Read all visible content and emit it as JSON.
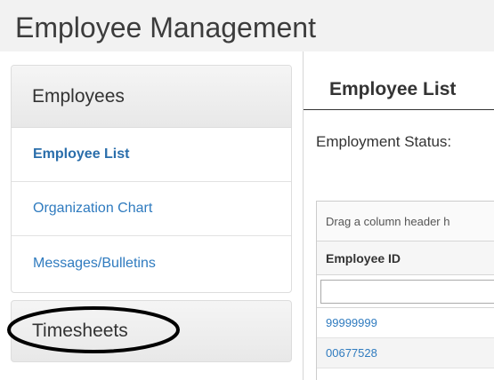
{
  "app": {
    "title": "Employee Management"
  },
  "sidebar": {
    "heading": "Employees",
    "items": [
      {
        "label": "Employee List",
        "active": true
      },
      {
        "label": "Organization Chart"
      },
      {
        "label": "Messages/Bulletins"
      }
    ],
    "section2_heading": "Timesheets"
  },
  "main": {
    "title": "Employee List",
    "status_label": "Employment Status:",
    "grid": {
      "group_hint": "Drag a column header h",
      "columns": [
        "Employee ID"
      ],
      "filter_value": "",
      "rows": [
        {
          "employee_id": "99999999"
        },
        {
          "employee_id": "00677528"
        }
      ]
    }
  },
  "colors": {
    "link": "#2f7bbf",
    "header_bg": "#f2f2f2",
    "annotation": "#000000"
  }
}
